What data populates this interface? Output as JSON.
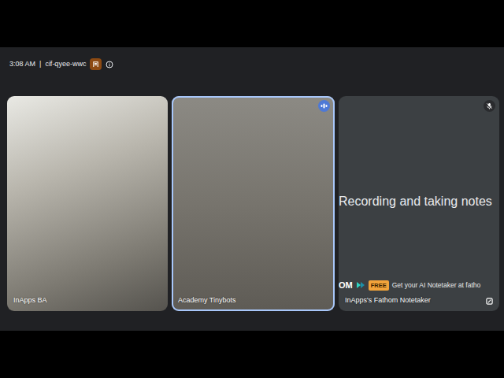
{
  "meeting": {
    "time": "3:08 AM",
    "separator": "|",
    "code": "cif-qyee-wwc"
  },
  "participants": [
    {
      "name": "InApps BA",
      "kind": "video",
      "speaking": false,
      "muted": false
    },
    {
      "name": "Academy Tinybots",
      "kind": "video",
      "speaking": true,
      "muted": false
    },
    {
      "name": "InApps's Fathom Notetaker",
      "kind": "bot",
      "speaking": false,
      "muted": true,
      "message": "Recording and taking notes",
      "brand": "OM",
      "badge": "FREE",
      "promo": "Get your AI Notetaker at fatho"
    }
  ]
}
